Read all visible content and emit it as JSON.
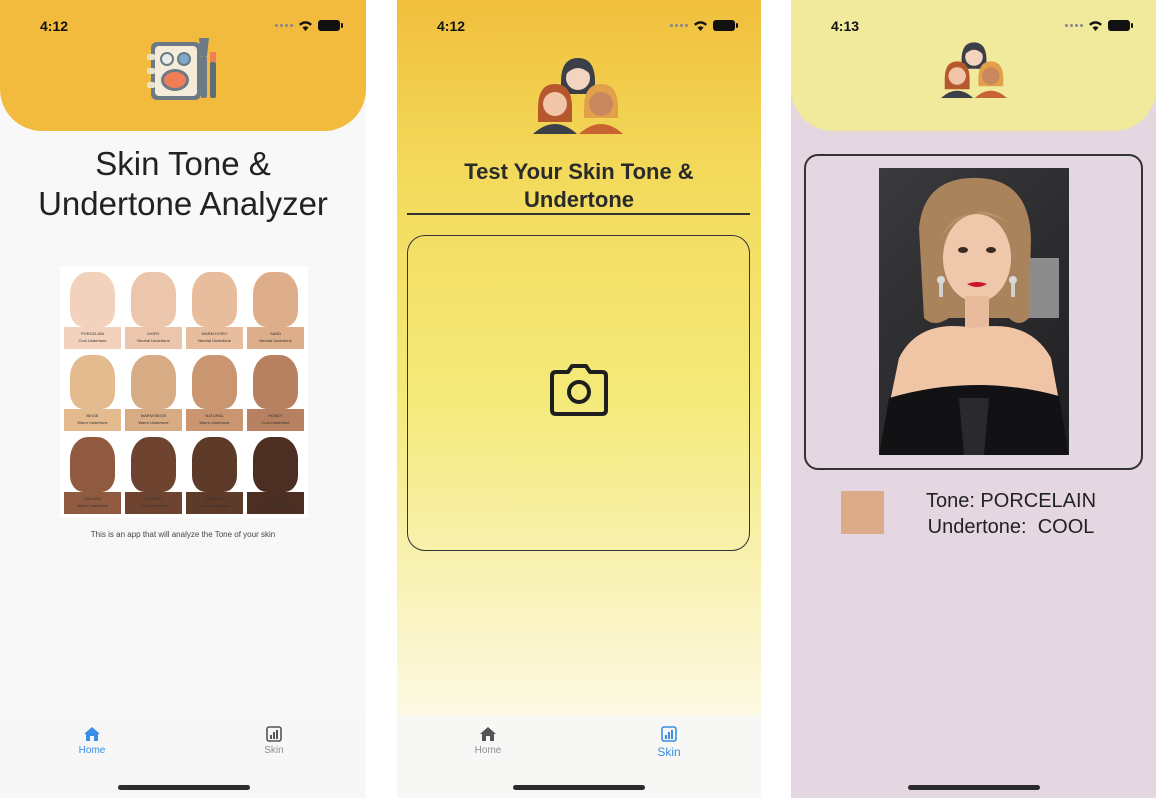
{
  "screens": [
    {
      "status_time": "4:12",
      "title_line1": "Skin Tone &",
      "title_line2": "Undertone Analyzer",
      "caption": "This is an app that will analyze the Tone of your skin",
      "tone_chart": [
        {
          "name": "PORCELAIN",
          "note": "Cool Undertone",
          "color": "#f2d2bd"
        },
        {
          "name": "IVORY",
          "note": "Neutral Undertone",
          "color": "#ecc6ac"
        },
        {
          "name": "WARM IVORY",
          "note": "Neutral Undertone",
          "color": "#e8bd9d"
        },
        {
          "name": "SAND",
          "note": "Neutral Undertone",
          "color": "#deae8b"
        },
        {
          "name": "BEIGE",
          "note": "Warm Undertone",
          "color": "#e3bb8f"
        },
        {
          "name": "WARM BEIGE",
          "note": "Warm Undertone",
          "color": "#d7ab84"
        },
        {
          "name": "NATURAL",
          "note": "Warm Undertone",
          "color": "#c99671"
        },
        {
          "name": "HONEY",
          "note": "Cool Undertone",
          "color": "#b78060"
        },
        {
          "name": "GOLDEN",
          "note": "Warm Undertone",
          "color": "#8f5a3f"
        },
        {
          "name": "ALMOND",
          "note": "Cool Undertone",
          "color": "#6e4330"
        },
        {
          "name": "CHESTNUT",
          "note": "Warm Undertone",
          "color": "#5e3a29"
        },
        {
          "name": "ESPRESSO",
          "note": "Cool Undertone",
          "color": "#4c2e22"
        }
      ],
      "tabs": [
        {
          "label": "Home"
        },
        {
          "label": "Skin"
        }
      ]
    },
    {
      "status_time": "4:12",
      "title_line1": "Test Your Skin Tone &",
      "title_line2": "Undertone",
      "tabs": [
        {
          "label": "Home"
        },
        {
          "label": "Skin"
        }
      ]
    },
    {
      "status_time": "4:13",
      "tone_label": "Tone: PORCELAIN",
      "undertone_label": "Undertone:  COOL",
      "swatch_color": "#dbab8a"
    }
  ],
  "colors": {
    "accent_blue": "#3a8ee6",
    "tab_inactive": "#8e8e93",
    "header_orange": "#f2bb3e",
    "header_yellow": "#f1ea9c"
  }
}
